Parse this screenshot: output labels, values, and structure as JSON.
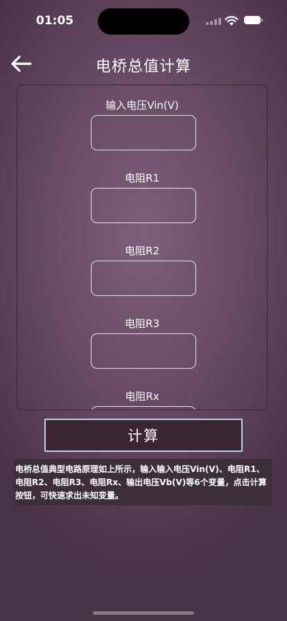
{
  "status_bar": {
    "time": "01:05"
  },
  "header": {
    "title": "电桥总值计算"
  },
  "form": {
    "fields": [
      {
        "label": "输入电压Vin(V)",
        "value": "",
        "placeholder": ""
      },
      {
        "label": "电阻R1",
        "value": "",
        "placeholder": ""
      },
      {
        "label": "电阻R2",
        "value": "",
        "placeholder": ""
      },
      {
        "label": "电阻R3",
        "value": "",
        "placeholder": ""
      },
      {
        "label": "电阻Rx",
        "value": "",
        "placeholder": ""
      }
    ]
  },
  "actions": {
    "calculate_label": "计算"
  },
  "description": "电桥总值典型电路原理如上所示，输入输入电压Vin(V)、电阻R1、电阻R2、电阻R3、电阻Rx、输出电压Vb(V)等6个变量，点击计算按钮，可快速求出未知变量。",
  "colors": {
    "accent_border": "#b9d4ee",
    "button_bg": "#3a2530",
    "desc_bg": "#3c2f3a"
  }
}
